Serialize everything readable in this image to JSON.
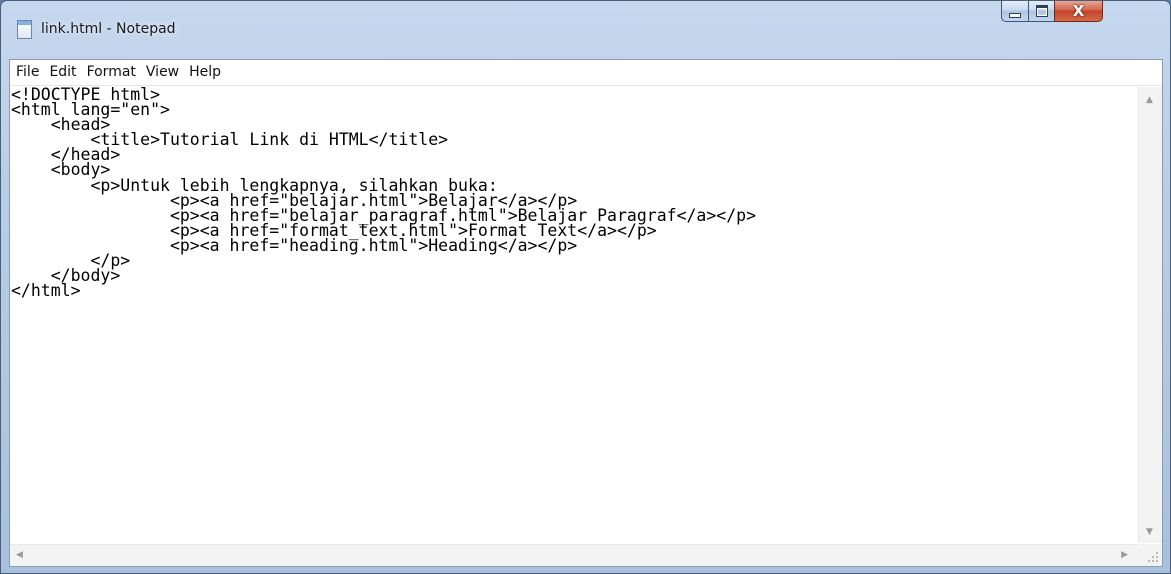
{
  "window": {
    "title": "link.html - Notepad",
    "caption_buttons": {
      "minimize": "minimize-icon",
      "maximize": "maximize-icon",
      "close": "close-icon"
    }
  },
  "menu": [
    "File",
    "Edit",
    "Format",
    "View",
    "Help"
  ],
  "editor": {
    "content": "<!DOCTYPE html>\n<html lang=\"en\">\n    <head>\n        <title>Tutorial Link di HTML</title>\n    </head>\n    <body>\n        <p>Untuk lebih lengkapnya, silahkan buka:\n                <p><a href=\"belajar.html\">Belajar</a></p>\n                <p><a href=\"belajar_paragraf.html\">Belajar Paragraf</a></p>\n                <p><a href=\"format_text.html\">Format Text</a></p>\n                <p><a href=\"heading.html\">Heading</a></p>\n        </p>\n    </body>\n</html>"
  },
  "colors": {
    "accent": "#c2432a",
    "frame": "#b8cde6"
  }
}
